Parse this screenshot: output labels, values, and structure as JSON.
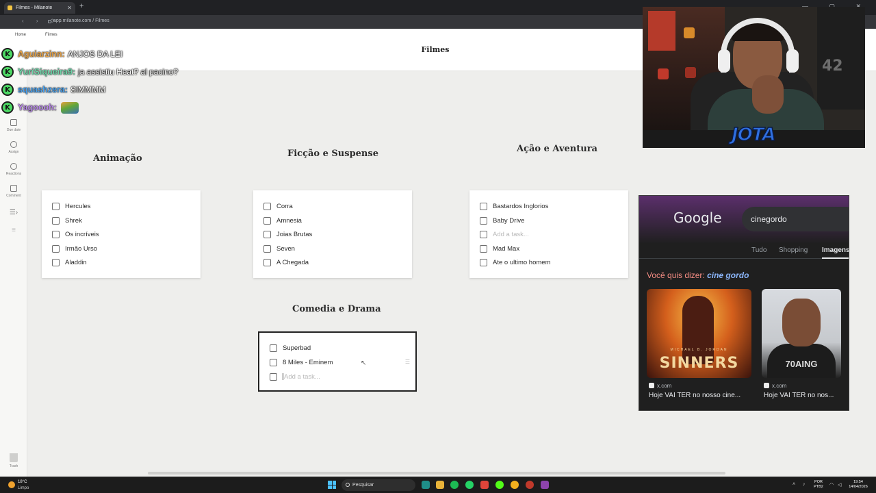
{
  "browser": {
    "tab_title": "Filmes - Milanote",
    "url": "app.milanote.com / Filmes"
  },
  "app": {
    "breadcrumb_home": "Home",
    "breadcrumb_current": "Filmes",
    "board_title": "Filmes"
  },
  "toolbar": {
    "items": [
      "Due date",
      "Assign",
      "Reactions",
      "Comment"
    ],
    "trash": "Trash"
  },
  "board": {
    "columns": [
      {
        "title": "Animação",
        "tasks": [
          "Hercules",
          "Shrek",
          "Os incríveis",
          "Irmão Urso",
          "Aladdin"
        ]
      },
      {
        "title": "Ficção e Suspense",
        "tasks": [
          "Corra",
          "Amnesia",
          "Joias Brutas",
          "Seven",
          "A Chegada"
        ]
      },
      {
        "title": "Ação e Aventura",
        "tasks": [
          "Bastardos Inglorios",
          "Baby Drive",
          "Mad Max",
          "Ate o ultimo homem"
        ],
        "placeholder": "Add a task..."
      },
      {
        "title": "Comedia e Drama",
        "tasks": [
          "Superbad",
          "8 Miles - Eminem"
        ],
        "placeholder": "Add a task..."
      }
    ]
  },
  "chat": {
    "messages": [
      {
        "user": "Aguiarzinn:",
        "text": "ANJOS DA LEI",
        "color": "#e6a34a"
      },
      {
        "user": "YuriSiqueira9:",
        "text": "ja assistiu Heat? al pacino?",
        "color": "#6fd3a8"
      },
      {
        "user": "squashzera:",
        "text": "SIMMMM",
        "color": "#4aa3f0"
      },
      {
        "user": "Yagoooh:",
        "text": "",
        "color": "#b98ae8"
      }
    ],
    "badge": "K"
  },
  "webcam": {
    "logo": "JOTA",
    "jersey_number": "42"
  },
  "google": {
    "logo": "Google",
    "query": "cinegordo",
    "tabs": [
      "Tudo",
      "Shopping",
      "Imagens"
    ],
    "did_you_mean_label": "Você quis dizer:",
    "did_you_mean_term": "cine gordo",
    "results": [
      {
        "source": "x.com",
        "caption": "Hoje VAI TER no nosso cine...",
        "image_text": "SINNERS",
        "image_top": "MICHAEL B. JORDAN"
      },
      {
        "source": "x.com",
        "caption": "Hoje VAI TER no nos...",
        "image_text": "70AING"
      }
    ]
  },
  "taskbar": {
    "temperature": "18°C",
    "condition": "Limpo",
    "search_placeholder": "Pesquisar",
    "lang": "POR",
    "layout": "PTB2",
    "time": "19:54",
    "date": "14/04/2026"
  }
}
